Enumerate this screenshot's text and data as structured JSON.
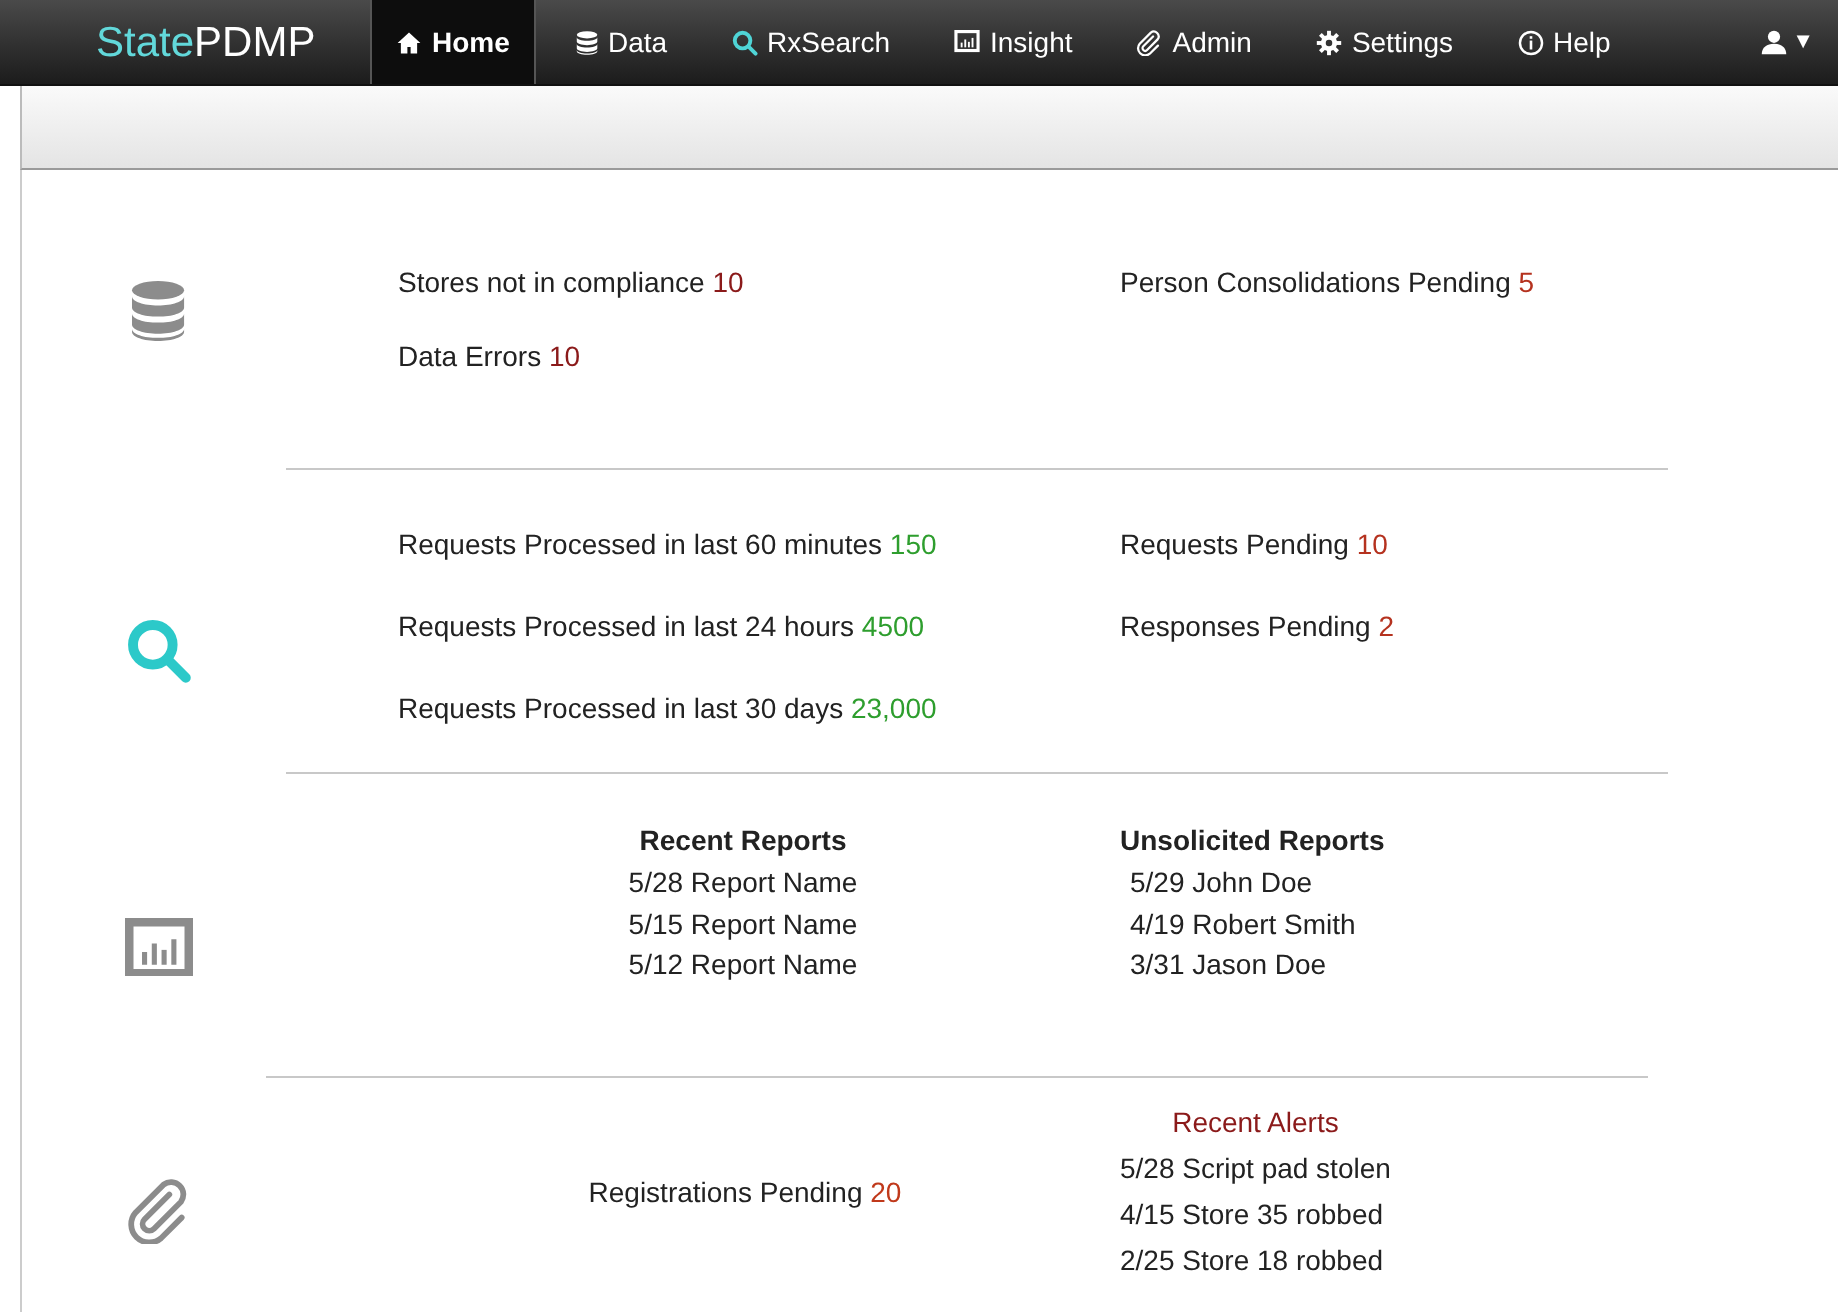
{
  "nav": {
    "brand_prefix": "State",
    "brand_name": "PDMP",
    "items": [
      {
        "label": "Home",
        "selected": true
      },
      {
        "label": "Data",
        "selected": false
      },
      {
        "label": "RxSearch",
        "selected": false
      },
      {
        "label": "Insight",
        "selected": false
      },
      {
        "label": "Admin",
        "selected": false
      },
      {
        "label": "Settings",
        "selected": false
      },
      {
        "label": "Help",
        "selected": false
      }
    ],
    "user_menu": {
      "caret": "▼"
    }
  },
  "sections": [
    {
      "left": {
        "kind": "stats",
        "items": [
          {
            "label": "Stores not in compliance",
            "value": "10",
            "color": "#8b1a1a"
          },
          {
            "label": "Data Errors",
            "value": "10",
            "color": "#8b1a1a"
          }
        ]
      },
      "right": {
        "kind": "stats",
        "items": [
          {
            "label": "Person Consolidations Pending",
            "value": "5",
            "color": "#b5321f"
          }
        ]
      }
    },
    {
      "left": {
        "kind": "stats",
        "items": [
          {
            "label": "Requests Processed in last 60 minutes",
            "value": "150",
            "color": "#2e9e2e"
          },
          {
            "label": "Requests Processed in last 24 hours",
            "value": "4500",
            "color": "#2e9e2e"
          },
          {
            "label": "Requests Processed in last 30 days",
            "value": "23,000",
            "color": "#2e9e2e"
          }
        ]
      },
      "right": {
        "kind": "stats",
        "items": [
          {
            "label": "Requests Pending",
            "value": "10",
            "color": "#b5321f"
          },
          {
            "label": "Responses Pending",
            "value": "2",
            "color": "#b5321f"
          }
        ]
      }
    },
    {
      "left": {
        "kind": "list",
        "title": "Recent Reports",
        "items": [
          "5/28 Report Name",
          "5/15 Report Name",
          "5/12 Report Name"
        ]
      },
      "right": {
        "kind": "list",
        "title": "Unsolicited Reports",
        "items": [
          "5/29 John Doe",
          "4/19 Robert Smith",
          "3/31 Jason Doe"
        ]
      }
    },
    {
      "left": {
        "kind": "stats",
        "items": [
          {
            "label": "Registrations Pending",
            "value": "20",
            "color": "#c0391b"
          }
        ]
      },
      "right": {
        "kind": "alerts",
        "title": "Recent Alerts",
        "items": [
          "5/28 Script pad stolen",
          "4/15 Store 35 robbed",
          "2/25 Store 18 robbed"
        ]
      }
    }
  ]
}
